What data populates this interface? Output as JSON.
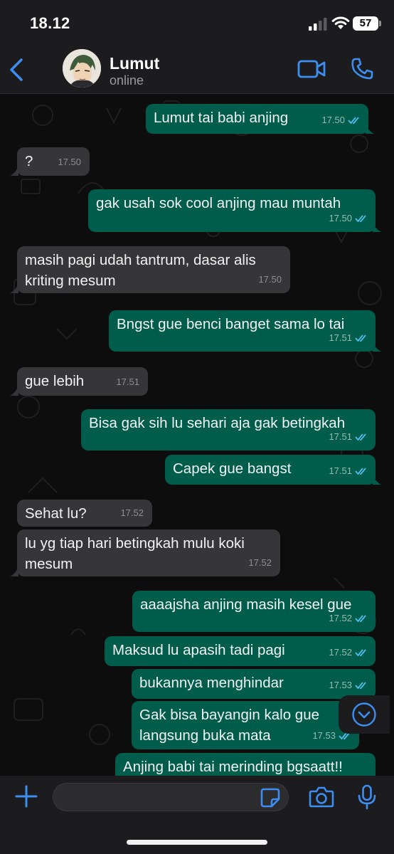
{
  "status_bar": {
    "time": "18.12",
    "battery": "57"
  },
  "header": {
    "name": "Lumut",
    "status": "online"
  },
  "input": {
    "placeholder": ""
  },
  "messages": [
    {
      "dir": "out",
      "text": "Lumut tai babi anjing",
      "time": "17.50",
      "read": true
    },
    {
      "dir": "in",
      "text": "?",
      "time": "17.50"
    },
    {
      "dir": "out",
      "text": "gak usah sok cool anjing mau muntah",
      "time": "17.50",
      "read": true
    },
    {
      "dir": "in",
      "text": "masih pagi udah tantrum, dasar alis kriting mesum",
      "time": "17.50"
    },
    {
      "dir": "out",
      "text": "Bngst gue benci banget sama lo tai",
      "time": "17.51",
      "read": true
    },
    {
      "dir": "in",
      "text": "gue lebih",
      "time": "17.51"
    },
    {
      "dir": "out",
      "text": "Bisa gak sih lu sehari aja gak betingkah",
      "time": "17.51",
      "read": true
    },
    {
      "dir": "out",
      "text": "Capek gue bangst",
      "time": "17.51",
      "read": true
    },
    {
      "dir": "in",
      "text": "Sehat lu?",
      "time": "17.52"
    },
    {
      "dir": "in",
      "text": "lu yg tiap hari betingkah mulu koki mesum",
      "time": "17.52"
    },
    {
      "dir": "out",
      "text": "aaaajsha anjing masih kesel gue",
      "time": "17.52",
      "read": true
    },
    {
      "dir": "out",
      "text": "Maksud lu apasih tadi pagi",
      "time": "17.52",
      "read": true
    },
    {
      "dir": "out",
      "text": "bukannya menghindar",
      "time": "17.53",
      "read": true
    },
    {
      "dir": "out",
      "text": "Gak bisa bayangin kalo gue langsung buka mata",
      "time": "17.53",
      "read": true
    },
    {
      "dir": "out",
      "text": "Anjing babi tai merinding bgsaatt!!",
      "time": "",
      "read": false
    }
  ],
  "colors": {
    "accent": "#3d8ef0",
    "outgoing": "#005c4b",
    "incoming": "#363638",
    "tick": "#53bdeb"
  },
  "icons": [
    "back-chevron-icon",
    "video-call-icon",
    "phone-icon",
    "plus-icon",
    "sticker-icon",
    "camera-icon",
    "mic-icon",
    "chevron-down-icon",
    "signal-icon",
    "wifi-icon"
  ]
}
